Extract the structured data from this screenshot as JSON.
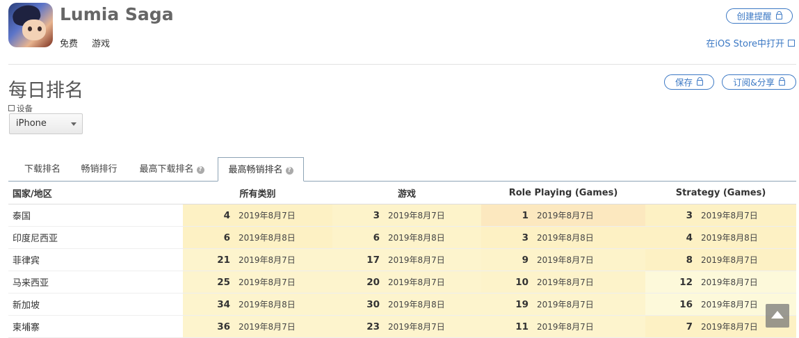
{
  "app": {
    "name": "Lumia Saga",
    "tags": [
      "免费",
      "游戏"
    ]
  },
  "header": {
    "alert_button": "创建提醒",
    "ios_store_link": "在iOS Store中打开"
  },
  "section": {
    "title": "每日排名",
    "save_button": "保存",
    "subscribe_button": "订阅&分享"
  },
  "device": {
    "label": "设备",
    "selected": "iPhone"
  },
  "tabs": [
    {
      "label": "下载排名",
      "help": false,
      "active": false
    },
    {
      "label": "畅销排行",
      "help": false,
      "active": false
    },
    {
      "label": "最高下载排名",
      "help": true,
      "active": false
    },
    {
      "label": "最高畅销排名",
      "help": true,
      "active": true
    }
  ],
  "table": {
    "headers": [
      "国家/地区",
      "所有类别",
      "游戏",
      "Role Playing (Games)",
      "Strategy (Games)"
    ],
    "rows": [
      {
        "country": "泰国",
        "cells": [
          {
            "rank": "4",
            "date": "2019年8月7日",
            "color": "#fdf1c4"
          },
          {
            "rank": "3",
            "date": "2019年8月7日",
            "color": "#fdf3ca"
          },
          {
            "rank": "1",
            "date": "2019年8月7日",
            "color": "#fce8bf"
          },
          {
            "rank": "3",
            "date": "2019年8月7日",
            "color": "#fdf1c4"
          }
        ]
      },
      {
        "country": "印度尼西亚",
        "cells": [
          {
            "rank": "6",
            "date": "2019年8月8日",
            "color": "#fdf1c4"
          },
          {
            "rank": "6",
            "date": "2019年8月8日",
            "color": "#fdf3ca"
          },
          {
            "rank": "3",
            "date": "2019年8月8日",
            "color": "#fdf1c4"
          },
          {
            "rank": "4",
            "date": "2019年8月8日",
            "color": "#fdf1c4"
          }
        ]
      },
      {
        "country": "菲律宾",
        "cells": [
          {
            "rank": "21",
            "date": "2019年8月7日",
            "color": "#fdf4cd"
          },
          {
            "rank": "17",
            "date": "2019年8月7日",
            "color": "#fdf4cd"
          },
          {
            "rank": "9",
            "date": "2019年8月7日",
            "color": "#fdf3ca"
          },
          {
            "rank": "8",
            "date": "2019年8月7日",
            "color": "#fdf1c4"
          }
        ]
      },
      {
        "country": "马来西亚",
        "cells": [
          {
            "rank": "25",
            "date": "2019年8月7日",
            "color": "#fdf4cd"
          },
          {
            "rank": "20",
            "date": "2019年8月7日",
            "color": "#fdf4cd"
          },
          {
            "rank": "10",
            "date": "2019年8月7日",
            "color": "#fdf3ca"
          },
          {
            "rank": "12",
            "date": "2019年8月7日",
            "color": "#fdf9da"
          }
        ]
      },
      {
        "country": "新加坡",
        "cells": [
          {
            "rank": "34",
            "date": "2019年8月8日",
            "color": "#fdf4cd"
          },
          {
            "rank": "30",
            "date": "2019年8月8日",
            "color": "#fdf4cd"
          },
          {
            "rank": "19",
            "date": "2019年8月7日",
            "color": "#fdf4cd"
          },
          {
            "rank": "16",
            "date": "2019年8月7日",
            "color": "#fdf9da"
          }
        ]
      },
      {
        "country": "柬埔寨",
        "cells": [
          {
            "rank": "36",
            "date": "2019年8月7日",
            "color": "#fdf4cd"
          },
          {
            "rank": "23",
            "date": "2019年8月7日",
            "color": "#fdf4cd"
          },
          {
            "rank": "11",
            "date": "2019年8月7日",
            "color": "#fdf4cd"
          },
          {
            "rank": "7",
            "date": "2019年8月7日",
            "color": "#fdf1c4"
          }
        ]
      }
    ]
  }
}
